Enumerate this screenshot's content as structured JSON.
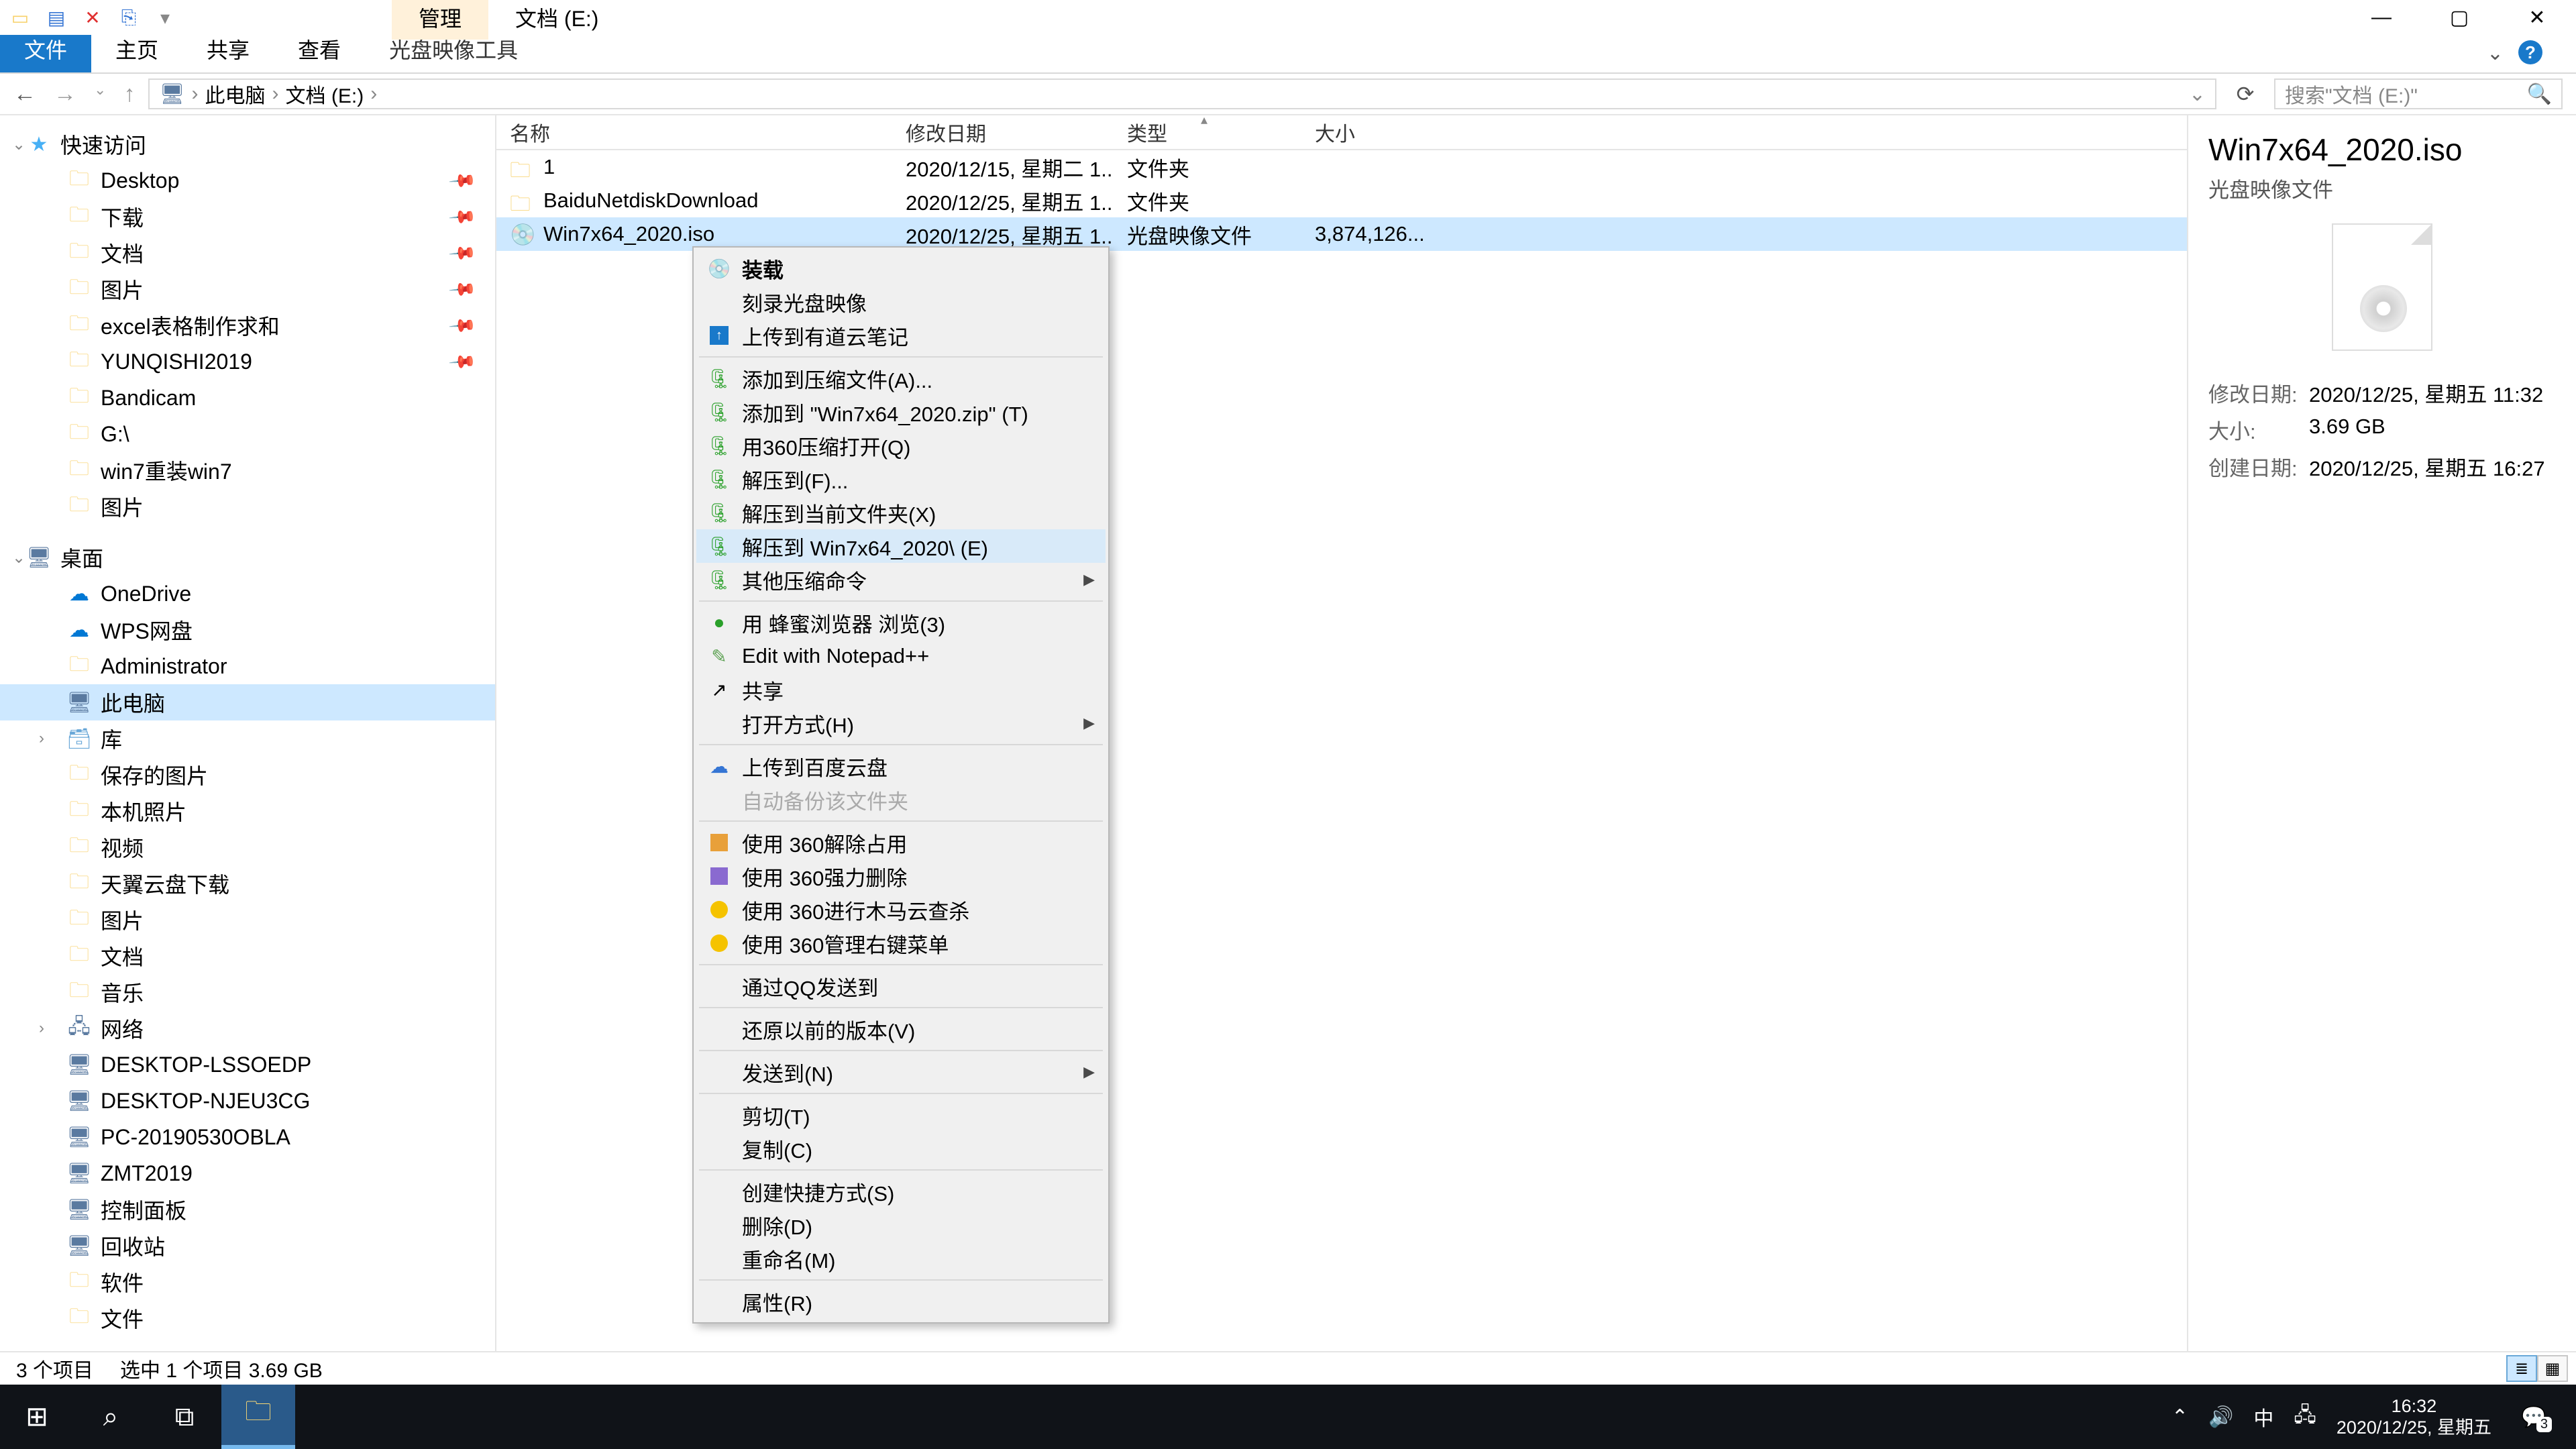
{
  "window": {
    "title_tabs": {
      "manage": "管理",
      "location": "文档 (E:)"
    }
  },
  "ribbon": {
    "file": "文件",
    "home": "主页",
    "share": "共享",
    "view": "查看",
    "disc_tools": "光盘映像工具"
  },
  "nav": {
    "crumb_pc": "此电脑",
    "crumb_loc": "文档 (E:)",
    "search_placeholder": "搜索\"文档 (E:)\""
  },
  "tree": {
    "quick": "快速访问",
    "items1": [
      {
        "label": "Desktop",
        "k": "folder",
        "pin": true
      },
      {
        "label": "下载",
        "k": "folder",
        "pin": true
      },
      {
        "label": "文档",
        "k": "folder",
        "pin": true
      },
      {
        "label": "图片",
        "k": "folder",
        "pin": true
      },
      {
        "label": "excel表格制作求和",
        "k": "folder",
        "pin": true
      },
      {
        "label": "YUNQISHI2019",
        "k": "folder",
        "pin": true
      },
      {
        "label": "Bandicam",
        "k": "folder",
        "pin": false
      },
      {
        "label": "G:\\",
        "k": "folder",
        "pin": false
      },
      {
        "label": "win7重装win7",
        "k": "folder",
        "pin": false
      },
      {
        "label": "图片",
        "k": "folder",
        "pin": false
      }
    ],
    "desktop": "桌面",
    "items2": [
      {
        "label": "OneDrive",
        "k": "cloud"
      },
      {
        "label": "WPS网盘",
        "k": "cloud"
      },
      {
        "label": "Administrator",
        "k": "folder"
      },
      {
        "label": "此电脑",
        "k": "pc",
        "sel": true
      },
      {
        "label": "库",
        "k": "lib",
        "chev": true
      },
      {
        "label": "保存的图片",
        "k": "folder",
        "d": 2
      },
      {
        "label": "本机照片",
        "k": "folder",
        "d": 2
      },
      {
        "label": "视频",
        "k": "folder",
        "d": 2
      },
      {
        "label": "天翼云盘下载",
        "k": "folder",
        "d": 2
      },
      {
        "label": "图片",
        "k": "folder",
        "d": 2
      },
      {
        "label": "文档",
        "k": "folder",
        "d": 2
      },
      {
        "label": "音乐",
        "k": "folder",
        "d": 2
      },
      {
        "label": "网络",
        "k": "net",
        "chev": true
      },
      {
        "label": "DESKTOP-LSSOEDP",
        "k": "pc",
        "d": 2
      },
      {
        "label": "DESKTOP-NJEU3CG",
        "k": "pc",
        "d": 2
      },
      {
        "label": "PC-20190530OBLA",
        "k": "pc",
        "d": 2
      },
      {
        "label": "ZMT2019",
        "k": "pc",
        "d": 2
      },
      {
        "label": "控制面板",
        "k": "pc"
      },
      {
        "label": "回收站",
        "k": "pc"
      },
      {
        "label": "软件",
        "k": "folder"
      },
      {
        "label": "文件",
        "k": "folder"
      }
    ]
  },
  "list": {
    "headers": {
      "name": "名称",
      "date": "修改日期",
      "type": "类型",
      "size": "大小"
    },
    "rows": [
      {
        "name": "1",
        "date": "2020/12/15, 星期二 1...",
        "type": "文件夹",
        "size": "",
        "icon": "folder"
      },
      {
        "name": "BaiduNetdiskDownload",
        "date": "2020/12/25, 星期五 1...",
        "type": "文件夹",
        "size": "",
        "icon": "folder"
      },
      {
        "name": "Win7x64_2020.iso",
        "date": "2020/12/25, 星期五 1...",
        "type": "光盘映像文件",
        "size": "3,874,126...",
        "icon": "disc",
        "sel": true
      }
    ]
  },
  "ctx": [
    {
      "label": "装载",
      "bold": true,
      "icon": "disc"
    },
    {
      "label": "刻录光盘映像"
    },
    {
      "label": "上传到有道云笔记",
      "icon": "blue-sq"
    },
    {
      "sep": true
    },
    {
      "label": "添加到压缩文件(A)...",
      "icon": "archive"
    },
    {
      "label": "添加到 \"Win7x64_2020.zip\" (T)",
      "icon": "archive"
    },
    {
      "label": "用360压缩打开(Q)",
      "icon": "archive"
    },
    {
      "label": "解压到(F)...",
      "icon": "archive"
    },
    {
      "label": "解压到当前文件夹(X)",
      "icon": "archive"
    },
    {
      "label": "解压到 Win7x64_2020\\ (E)",
      "icon": "archive",
      "hover": true
    },
    {
      "label": "其他压缩命令",
      "icon": "archive",
      "sub": true
    },
    {
      "sep": true
    },
    {
      "label": "用 蜂蜜浏览器 浏览(3)",
      "icon": "green-dot"
    },
    {
      "label": "Edit with Notepad++",
      "icon": "npp"
    },
    {
      "label": "共享",
      "icon": "share"
    },
    {
      "label": "打开方式(H)",
      "sub": true
    },
    {
      "sep": true
    },
    {
      "label": "上传到百度云盘",
      "icon": "cloud-sm"
    },
    {
      "label": "自动备份该文件夹",
      "disabled": true
    },
    {
      "sep": true
    },
    {
      "label": "使用 360解除占用",
      "icon": "orange-sq"
    },
    {
      "label": "使用 360强力删除",
      "icon": "purple-sq"
    },
    {
      "label": "使用 360进行木马云查杀",
      "icon": "yellow-ball"
    },
    {
      "label": "使用 360管理右键菜单",
      "icon": "yellow-ball"
    },
    {
      "sep": true
    },
    {
      "label": "通过QQ发送到"
    },
    {
      "sep": true
    },
    {
      "label": "还原以前的版本(V)"
    },
    {
      "sep": true
    },
    {
      "label": "发送到(N)",
      "sub": true
    },
    {
      "sep": true
    },
    {
      "label": "剪切(T)"
    },
    {
      "label": "复制(C)"
    },
    {
      "sep": true
    },
    {
      "label": "创建快捷方式(S)"
    },
    {
      "label": "删除(D)"
    },
    {
      "label": "重命名(M)"
    },
    {
      "sep": true
    },
    {
      "label": "属性(R)"
    }
  ],
  "preview": {
    "title": "Win7x64_2020.iso",
    "subtitle": "光盘映像文件",
    "rows": [
      {
        "label": "修改日期:",
        "val": "2020/12/25, 星期五 11:32"
      },
      {
        "label": "大小:",
        "val": "3.69 GB"
      },
      {
        "label": "创建日期:",
        "val": "2020/12/25, 星期五 16:27"
      }
    ]
  },
  "status": {
    "count": "3 个项目",
    "sel": "选中 1 个项目  3.69 GB"
  },
  "taskbar": {
    "time": "16:32",
    "date": "2020/12/25, 星期五",
    "ime": "中",
    "notif_count": "3"
  }
}
